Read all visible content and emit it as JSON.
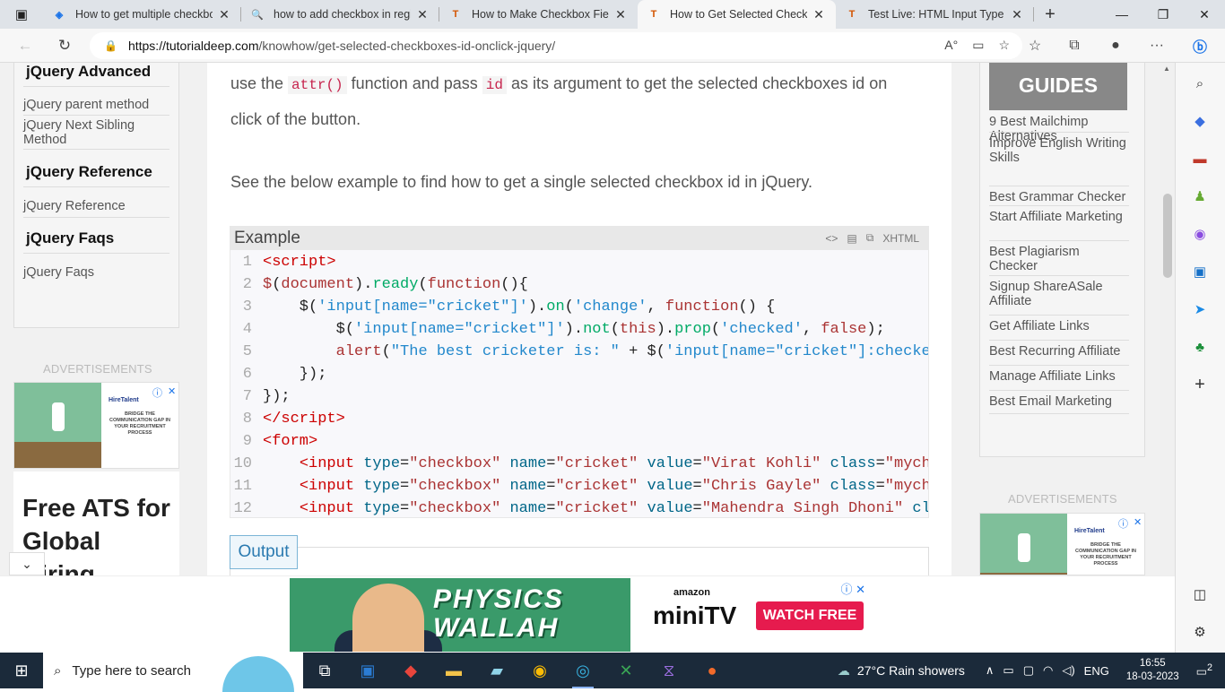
{
  "browser": {
    "tabs": [
      {
        "title": "How to get multiple checkbox",
        "fav": "◈",
        "active": false
      },
      {
        "title": "how to add checkbox in regis",
        "fav": "🔍",
        "active": false
      },
      {
        "title": "How to Make Checkbox Field",
        "fav": "T",
        "active": false
      },
      {
        "title": "How to Get Selected Checkbo",
        "fav": "T",
        "active": true
      },
      {
        "title": "Test Live: HTML Input Type Ch",
        "fav": "T",
        "active": false
      }
    ],
    "tab_close": "✕",
    "new_tab": "+",
    "url_host": "https://tutorialdeep.com",
    "url_path": "/knowhow/get-selected-checkboxes-id-onclick-jquery/"
  },
  "left_sidebar": {
    "sections": [
      {
        "heading": "jQuery Advanced",
        "links": [
          "jQuery parent method",
          "jQuery Next Sibling Method"
        ]
      },
      {
        "heading": "jQuery Reference",
        "links": [
          "jQuery Reference"
        ]
      },
      {
        "heading": "jQuery Faqs",
        "links": [
          "jQuery Faqs"
        ]
      }
    ],
    "ad_label": "ADVERTISEMENTS",
    "ad_brand": "HireTalent",
    "ad_text": "BRIDGE THE COMMUNICATION GAP IN YOUR RECRUITMENT PROCESS",
    "ats_text": "Free ATS for Global Hiring"
  },
  "article": {
    "para1_a": "use the ",
    "para1_code1": "attr()",
    "para1_b": " function and pass ",
    "para1_code2": "id",
    "para1_c": " as its argument to get the selected checkboxes id on",
    "para1_d": "click of the button.",
    "para2": "See the below example to find how to get a single selected checkbox id in jQuery.",
    "example_title": "Example",
    "example_lang": "XHTML",
    "output_label": "Output"
  },
  "code_lines": [
    {
      "n": "1",
      "html": "<span class='tag'>&lt;script&gt;</span>"
    },
    {
      "n": "2",
      "html": "<span class='brown'>$</span>(<span class='brown'>document</span>).<span class='fn'>ready</span>(<span class='brown'>function</span>(){"
    },
    {
      "n": "3",
      "html": "    $(<span class='str'>'input[name=\"cricket\"]'</span>).<span class='fn'>on</span>(<span class='str'>'change'</span>, <span class='brown'>function</span>() {"
    },
    {
      "n": "4",
      "html": "        $(<span class='str'>'input[name=\"cricket\"]'</span>).<span class='fn'>not</span>(<span class='brown'>this</span>).<span class='fn'>prop</span>(<span class='str'>'checked'</span>, <span class='brown'>false</span>);"
    },
    {
      "n": "5",
      "html": "        <span class='brown'>alert</span>(<span class='str'>\"The best cricketer is: \"</span> + $(<span class='str'>'input[name=\"cricket\"]:checke</span>"
    },
    {
      "n": "6",
      "html": "    });"
    },
    {
      "n": "7",
      "html": "});"
    },
    {
      "n": "8",
      "html": "<span class='tag'>&lt;/script&gt;</span>"
    },
    {
      "n": "9",
      "html": "<span class='tag'>&lt;form&gt;</span>"
    },
    {
      "n": "10",
      "html": "    <span class='tag'>&lt;input</span> <span class='at'>type</span>=<span class='brown'>\"checkbox\"</span> <span class='at'>name</span>=<span class='brown'>\"cricket\"</span> <span class='at'>value</span>=<span class='brown'>\"Virat Kohli\"</span> <span class='at'>class</span>=<span class='brown'>\"mych</span>"
    },
    {
      "n": "11",
      "html": "    <span class='tag'>&lt;input</span> <span class='at'>type</span>=<span class='brown'>\"checkbox\"</span> <span class='at'>name</span>=<span class='brown'>\"cricket\"</span> <span class='at'>value</span>=<span class='brown'>\"Chris Gayle\"</span> <span class='at'>class</span>=<span class='brown'>\"mych</span>"
    },
    {
      "n": "12",
      "html": "    <span class='tag'>&lt;input</span> <span class='at'>type</span>=<span class='brown'>\"checkbox\"</span> <span class='at'>name</span>=<span class='brown'>\"cricket\"</span> <span class='at'>value</span>=<span class='brown'>\"Mahendra Singh Dhoni\"</span> <span class='at'>cl</span>"
    }
  ],
  "right_sidebar": {
    "guides_title": "GUIDES",
    "links": [
      "9 Best Mailchimp Alternatives",
      "Improve English Writing Skills",
      "Best Grammar Checker",
      "Start Affiliate Marketing",
      "Best Plagiarism Checker",
      "Signup ShareASale Affiliate",
      "Get Affiliate Links",
      "Best Recurring Affiliate",
      "Manage Affiliate Links",
      "Best Email Marketing"
    ],
    "ad_label": "ADVERTISEMENTS",
    "ad_brand": "HireTalent",
    "ad_text": "BRIDGE THE COMMUNICATION GAP IN YOUR RECRUITMENT PROCESS"
  },
  "bottom_ad": {
    "title_line1": "PHYSICS",
    "title_line2": "WALLAH",
    "amazon": "amazon",
    "minitv": "miniTV",
    "watch": "WATCH FREE"
  },
  "taskbar": {
    "search_placeholder": "Type here to search",
    "weather": "27°C  Rain showers",
    "lang": "ENG",
    "time": "16:55",
    "date": "18-03-2023",
    "notifications": "2"
  },
  "icons": [
    "tab-actions-icon",
    "reload-icon",
    "lock-icon",
    "read-aloud-icon",
    "favorites-icon",
    "collections-icon",
    "profile-icon",
    "menu-icon",
    "bing-icon",
    "search-icon",
    "windows-icon"
  ]
}
